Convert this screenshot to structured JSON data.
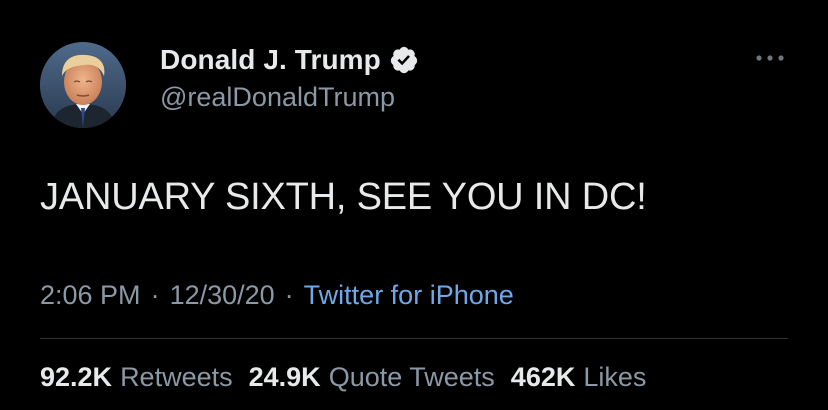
{
  "tweet": {
    "author": {
      "display_name": "Donald J. Trump",
      "handle": "@realDonaldTrump",
      "verified": true,
      "avatar_icon": "profile-photo"
    },
    "more_icon": "ellipsis-icon",
    "text": "JANUARY SIXTH, SEE YOU IN DC!",
    "meta": {
      "time": "2:06 PM",
      "separator": "·",
      "date": "12/30/20",
      "source": "Twitter for iPhone"
    },
    "stats": [
      {
        "value": "92.2K",
        "label": "Retweets"
      },
      {
        "value": "24.9K",
        "label": "Quote Tweets"
      },
      {
        "value": "462K",
        "label": "Likes"
      }
    ]
  },
  "colors": {
    "background": "#000000",
    "primary_text": "#e7e9ea",
    "secondary_text": "#8b98a5",
    "link": "#6fa8e8",
    "divider": "#2f3336",
    "verified_badge": "#e7e9ea"
  }
}
